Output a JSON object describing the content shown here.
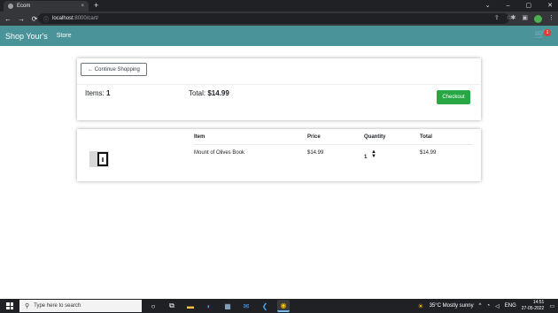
{
  "browser": {
    "tab_title": "Ecom",
    "tab_close": "×",
    "new_tab": "+",
    "window_controls": [
      "⌄",
      "–",
      "▢",
      "✕"
    ],
    "url_host": "localhost",
    "url_path": ":8000/cart/",
    "nav": {
      "back": "←",
      "forward": "→",
      "reload": "⟳"
    },
    "icons": [
      "share-icon",
      "star-icon",
      "extensions-icon",
      "sidebar-icon",
      "profile-icon",
      "menu-icon"
    ]
  },
  "navbar": {
    "brand": "Shop Your's",
    "store_link": "Store",
    "cart_count": "1",
    "cart_icon": "🛒"
  },
  "summary": {
    "continue_label": "← Continue Shopping",
    "items_label": "Items:",
    "items_count": "1",
    "total_label": "Total:",
    "total_value": "$14.99",
    "checkout_label": "Checkout"
  },
  "cart_table": {
    "headers": {
      "item": "Item",
      "price": "Price",
      "quantity": "Quantity",
      "total": "Total"
    },
    "rows": [
      {
        "name": "Mount of Olives Book",
        "price": "$14.99",
        "quantity": "1",
        "total": "$14.99"
      }
    ],
    "qty_up": "▲",
    "qty_down": "▼"
  },
  "taskbar": {
    "search_placeholder": "Type here to search",
    "weather": "35°C  Mostly sunny",
    "language": "ENG",
    "time": "14:51",
    "date": "27-05-2022"
  },
  "colors": {
    "navbar": "#4a9399",
    "checkout": "#28a745",
    "badge": "#e53935"
  }
}
